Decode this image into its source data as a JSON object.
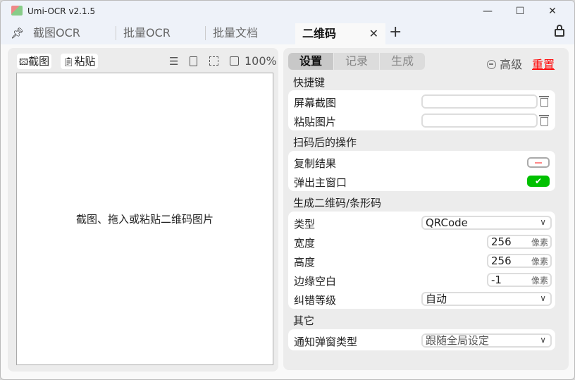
{
  "window": {
    "title": "Umi-OCR v2.1.5",
    "controls": {
      "minimize": "—",
      "maximize": "☐",
      "close": "✕"
    }
  },
  "tabs": [
    {
      "label": "截图OCR"
    },
    {
      "label": "批量OCR"
    },
    {
      "label": "批量文档"
    },
    {
      "label": "二维码",
      "active": true
    }
  ],
  "tab_add": "+",
  "left": {
    "screenshot_label": "截图",
    "paste_label": "粘贴",
    "zoom": "100%",
    "placeholder": "截图、拖入或粘贴二维码图片"
  },
  "right": {
    "tabs": [
      {
        "label": "设置",
        "active": true
      },
      {
        "label": "记录"
      },
      {
        "label": "生成"
      }
    ],
    "advanced_label": "高级",
    "reset_label": "重置",
    "groups": {
      "hotkeys": {
        "title": "快捷键",
        "items": [
          {
            "label": "屏幕截图",
            "value": ""
          },
          {
            "label": "粘贴图片",
            "value": ""
          }
        ]
      },
      "after_scan": {
        "title": "扫码后的操作",
        "items": [
          {
            "label": "复制结果",
            "checked": false
          },
          {
            "label": "弹出主窗口",
            "checked": true
          }
        ]
      },
      "generate": {
        "title": "生成二维码/条形码",
        "type_label": "类型",
        "type_value": "QRCode",
        "width_label": "宽度",
        "width_value": "256",
        "height_label": "高度",
        "height_value": "256",
        "margin_label": "边缘空白",
        "margin_value": "-1",
        "unit": "像素",
        "ec_label": "纠错等级",
        "ec_value": "自动"
      },
      "other": {
        "title": "其它",
        "notify_label": "通知弹窗类型",
        "notify_value": "跟随全局设定"
      }
    }
  },
  "colors": {
    "reset": "#ff0000",
    "toggle_on": "#00c000"
  }
}
